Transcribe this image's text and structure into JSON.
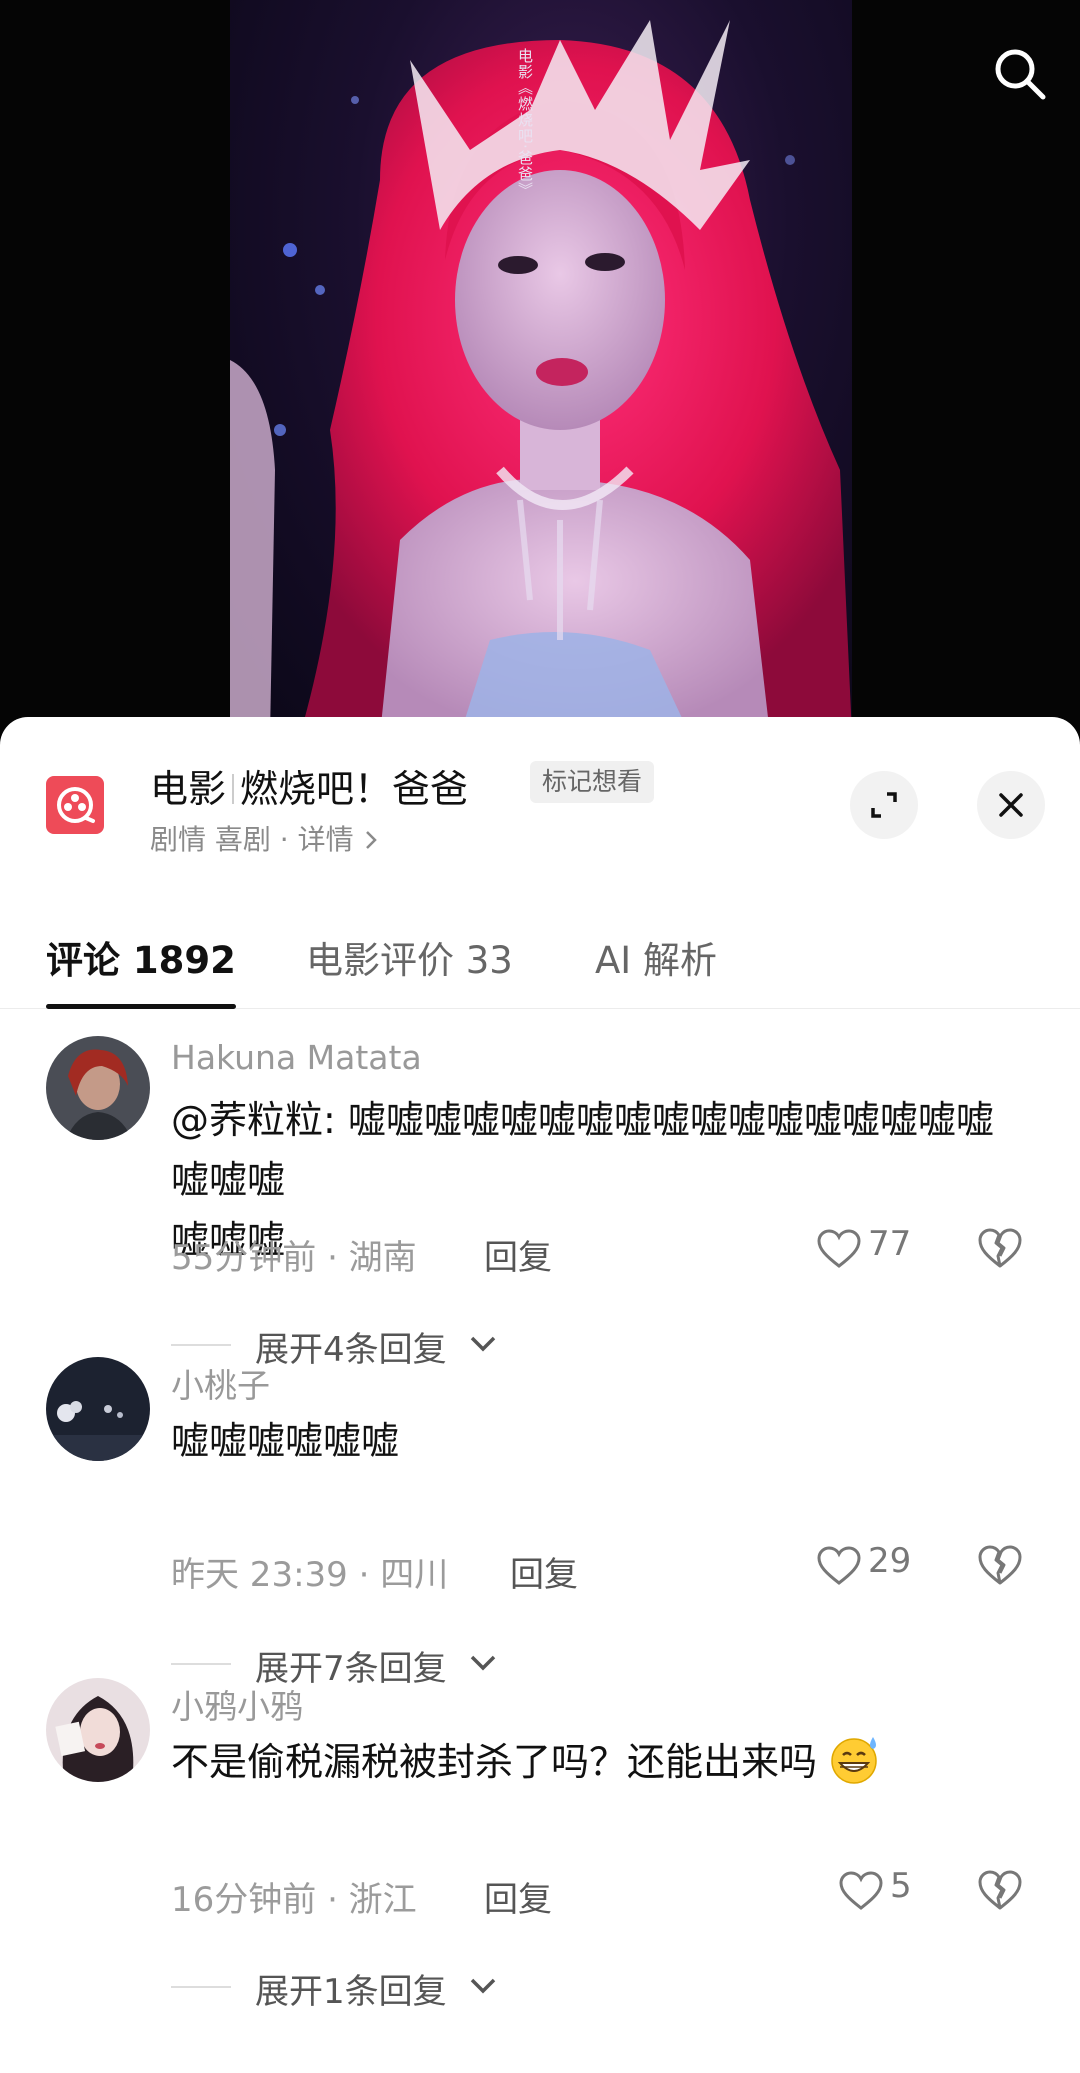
{
  "video": {
    "caption": "电影《燃烧吧·爸爸》"
  },
  "header": {
    "film_title_prefix": "电影",
    "film_title": "燃烧吧！爸爸",
    "mark_button": "标记想看",
    "meta": "剧情 喜剧 · 详情"
  },
  "tabs": [
    {
      "label": "评论 1892",
      "active": true
    },
    {
      "label": "电影评价 33",
      "active": false
    },
    {
      "label": "AI 解析",
      "active": false
    }
  ],
  "comments": [
    {
      "username": "Hakuna Matata",
      "text_lines": [
        "@荞粒粒: 嘘嘘嘘嘘嘘嘘嘘嘘嘘嘘嘘嘘嘘嘘嘘嘘嘘嘘嘘嘘",
        "嘘嘘嘘"
      ],
      "meta": "55分钟前 · 湖南",
      "reply": "回复",
      "likes": "77",
      "expand": "展开4条回复"
    },
    {
      "username": "小桃子",
      "text_lines": [
        "嘘嘘嘘嘘嘘嘘"
      ],
      "meta": "昨天 23:39 · 四川",
      "reply": "回复",
      "likes": "29",
      "expand": "展开7条回复"
    },
    {
      "username": "小鸦小鸦",
      "text_lines": [
        "不是偷税漏税被封杀了吗？还能出来吗"
      ],
      "meta": "16分钟前 · 浙江",
      "reply": "回复",
      "likes": "5",
      "expand": "展开1条回复"
    }
  ],
  "icons": {
    "search": "search-icon",
    "expand": "expand-icon",
    "close": "close-icon",
    "like": "heart-icon",
    "dislike": "broken-heart-icon",
    "chevron": "chevron-down-icon",
    "emoji": "grinning-sweat-emoji"
  },
  "colors": {
    "film_icon": "#ee4b58",
    "text_primary": "#111111",
    "text_secondary": "#9b9b9b"
  }
}
